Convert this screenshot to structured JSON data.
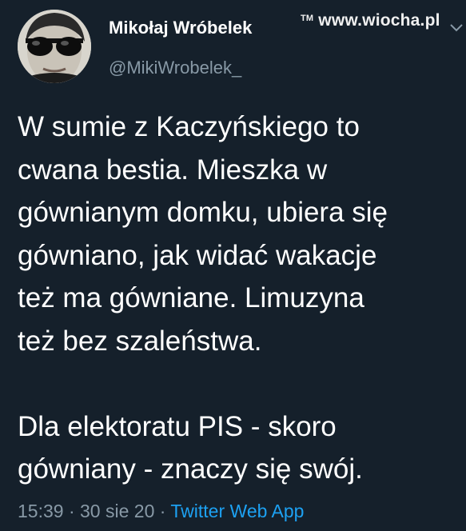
{
  "author": {
    "display_name": "Mikołaj Wróbelek",
    "handle": "@MikiWrobelek_"
  },
  "watermark": {
    "tm": "TM",
    "site": "www.wiocha.pl"
  },
  "tweet": {
    "lines": [
      "W sumie z Kaczyńskiego to",
      "cwana bestia. Mieszka w",
      "gównianym domku, ubiera się",
      "gówniano, jak widać wakacje",
      "też ma gówniane. Limuzyna",
      "też bez szaleństwa."
    ],
    "lines2": [
      "Dla elektoratu PIS - skoro",
      "gówniany - znaczy się swój."
    ]
  },
  "meta": {
    "time": "15:39",
    "separator": " · ",
    "date": "30 sie 20",
    "source": "Twitter Web App"
  },
  "colors": {
    "background": "#15202b",
    "secondary_text": "#8899a6",
    "link": "#1da1f2"
  },
  "icons": {
    "more": "chevron-down-icon",
    "avatar": "avatar-sunglasses"
  }
}
